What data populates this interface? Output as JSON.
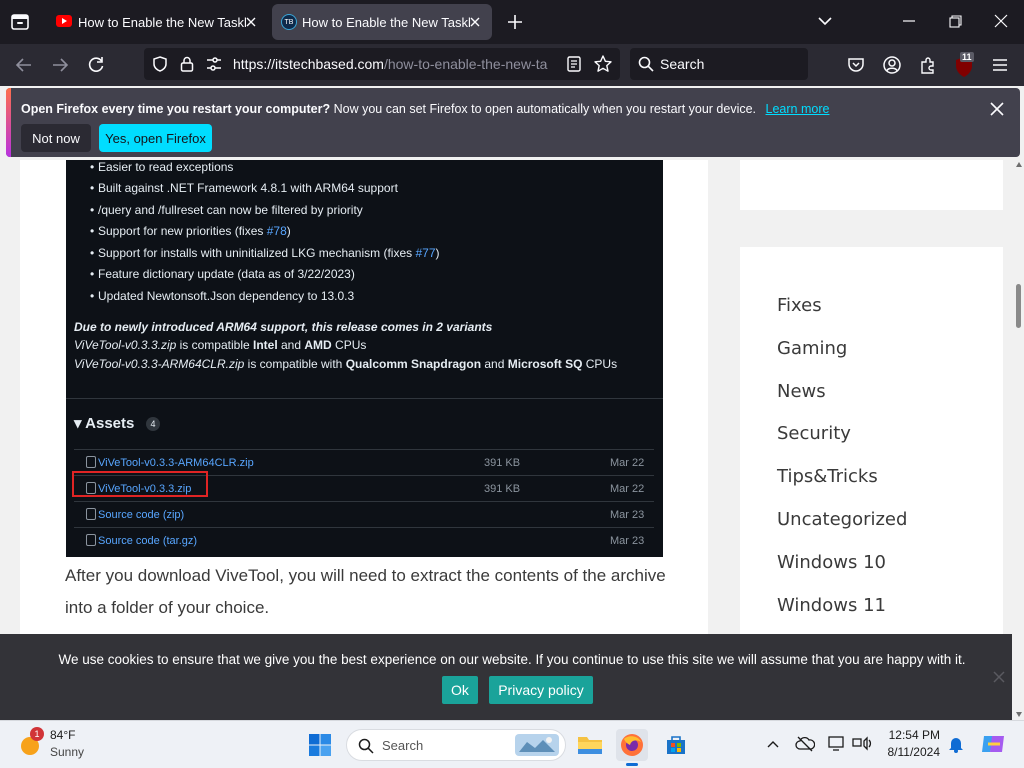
{
  "browser": {
    "tabs": [
      {
        "title": "How to Enable the New Taskbar",
        "active": false
      },
      {
        "title": "How to Enable the New Taskbar",
        "active": true
      }
    ],
    "url_domain": "https://itstechbased.com",
    "url_path": "/how-to-enable-the-new-ta",
    "search_placeholder": "Search",
    "extension_badge": "11"
  },
  "notification": {
    "bold_text": "Open Firefox every time you restart your computer?",
    "text": " Now you can set Firefox to open automatically when you restart your device.",
    "learn_more": "Learn more",
    "not_now": "Not now",
    "yes_open": "Yes, open Firefox"
  },
  "release_notes": {
    "bullets": [
      {
        "text": "Easier to read exceptions",
        "link": ""
      },
      {
        "text": "Built against .NET Framework 4.8.1 with ARM64 support",
        "link": ""
      },
      {
        "text": "/query and /fullreset can now be filtered by priority",
        "link": ""
      },
      {
        "text": "Support for new priorities (fixes ",
        "link": "#78",
        "after": ")"
      },
      {
        "text": "Support for installs with uninitialized LKG mechanism (fixes ",
        "link": "#77",
        "after": ")"
      },
      {
        "text": "Feature dictionary update (data as of 3/22/2023)",
        "link": ""
      },
      {
        "text": "Updated Newtonsoft.Json dependency to 13.0.3",
        "link": ""
      }
    ],
    "variants_heading": "Due to newly introduced ARM64 support, this release comes in 2 variants",
    "variant1_file": "ViVeTool-v0.3.3.zip",
    "variant1_mid": " is compatible ",
    "variant1_bold1": "Intel",
    "variant1_and": " and ",
    "variant1_bold2": "AMD",
    "variant1_end": " CPUs",
    "variant2_file": "ViVeTool-v0.3.3-ARM64CLR.zip",
    "variant2_mid": " is compatible with ",
    "variant2_bold1": "Qualcomm Snapdragon",
    "variant2_and": " and ",
    "variant2_bold2": "Microsoft SQ",
    "variant2_end": " CPUs",
    "assets_label": "Assets",
    "assets_count": "4",
    "assets": [
      {
        "name": "ViVeTool-v0.3.3-ARM64CLR.zip",
        "size": "391 KB",
        "date": "Mar 22"
      },
      {
        "name": "ViVeTool-v0.3.3.zip",
        "size": "391 KB",
        "date": "Mar 22"
      },
      {
        "name": "Source code (zip)",
        "size": "",
        "date": "Mar 23"
      },
      {
        "name": "Source code (tar.gz)",
        "size": "",
        "date": "Mar 23"
      }
    ]
  },
  "article_text": "After you download ViveTool, you will need to extract the contents of the archive into a folder of your choice.",
  "categories": [
    "Fixes",
    "Gaming",
    "News",
    "Security",
    "Tips&Tricks",
    "Uncategorized",
    "Windows 10",
    "Windows 11"
  ],
  "cookie": {
    "text": "We use cookies to ensure that we give you the best experience on our website. If you continue to use this site we will assume that you are happy with it.",
    "ok": "Ok",
    "privacy": "Privacy policy"
  },
  "taskbar": {
    "weather_temp": "84°F",
    "weather_desc": "Sunny",
    "weather_badge": "1",
    "search_label": "Search",
    "time": "12:54 PM",
    "date": "8/11/2024"
  },
  "colors": {
    "accent": "#00ddff",
    "cookie_btn": "#1aa39a",
    "link": "#58a6ff",
    "highlight": "#e02424"
  }
}
